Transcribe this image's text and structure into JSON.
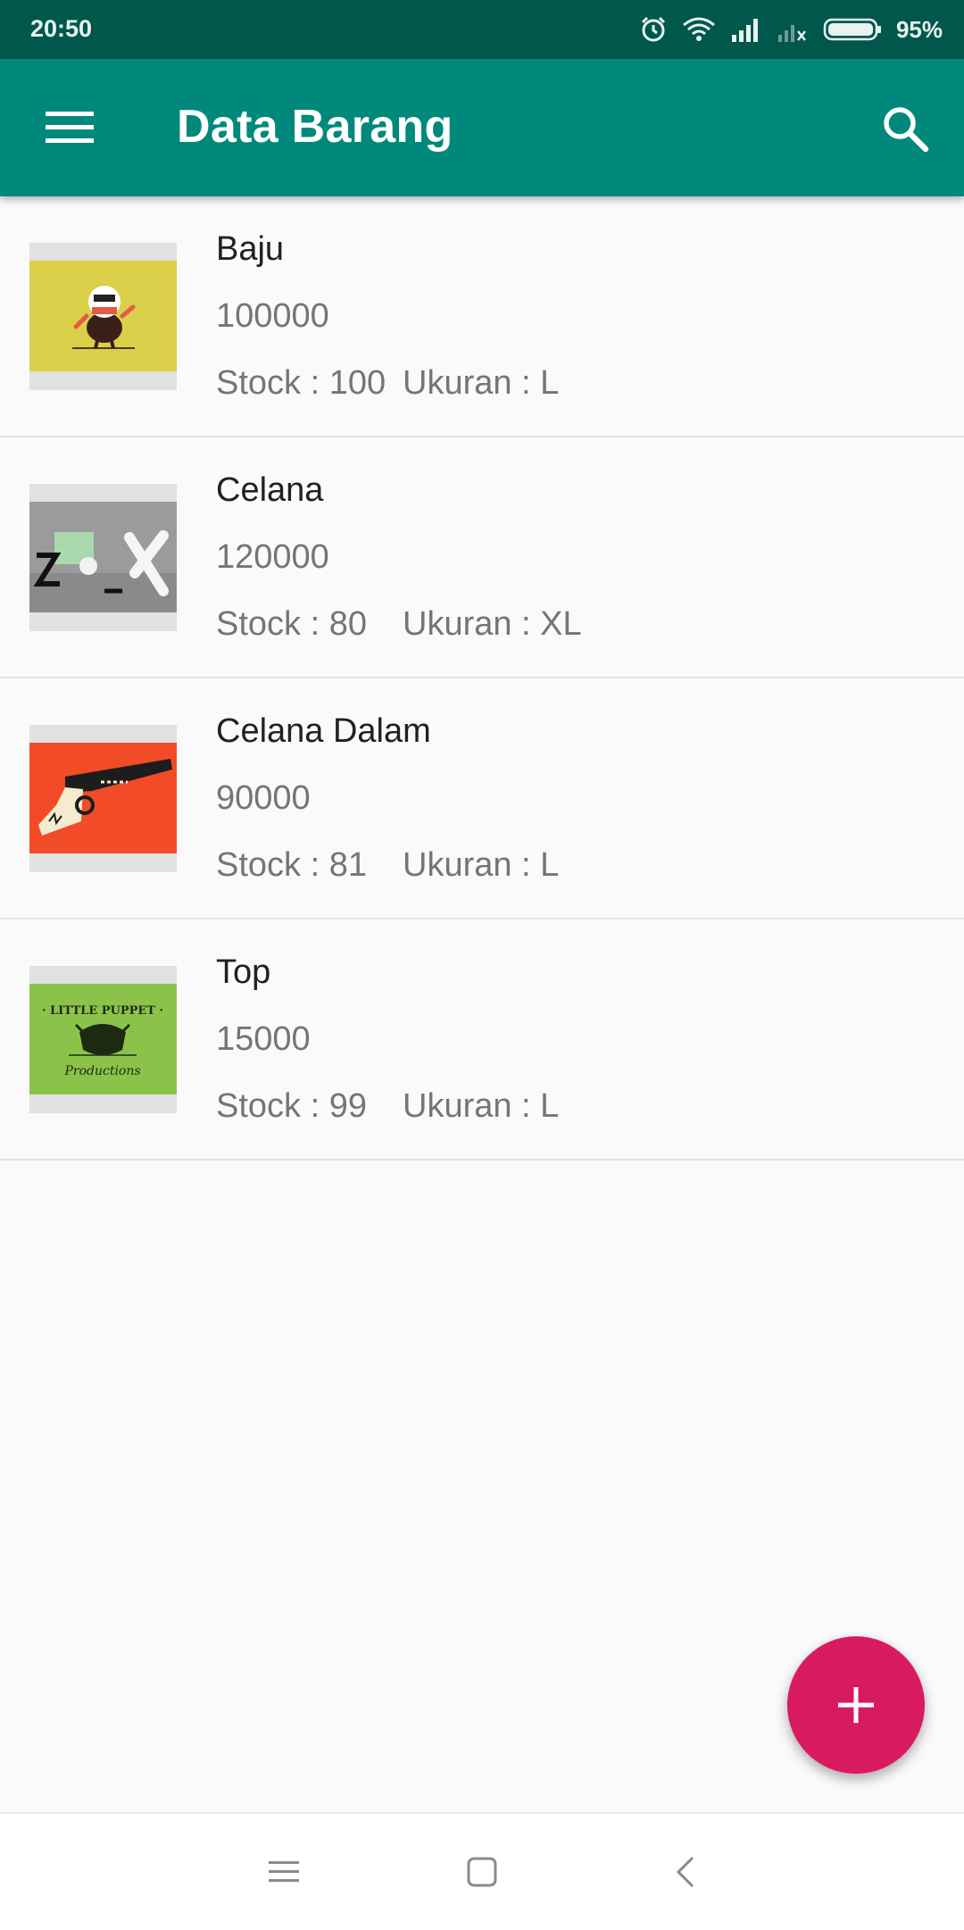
{
  "status_bar": {
    "time": "20:50",
    "battery": "95%",
    "icons": [
      "alarm-icon",
      "wifi-icon",
      "signal-icon",
      "no-signal-icon",
      "battery-icon"
    ]
  },
  "app_bar": {
    "title": "Data Barang",
    "menu_icon": "menu-icon",
    "search_icon": "search-icon",
    "color": "#00897b"
  },
  "items": [
    {
      "name": "Baju",
      "price": "100000",
      "stock": "Stock : 100",
      "size": "Ukuran : L",
      "thumb_bg": "#dccf4a"
    },
    {
      "name": "Celana",
      "price": "120000",
      "stock": "Stock : 80",
      "size": "Ukuran : XL",
      "thumb_bg": "#9b9b9b"
    },
    {
      "name": "Celana Dalam",
      "price": "90000",
      "stock": "Stock : 81",
      "size": "Ukuran : L",
      "thumb_bg": "#f24b27"
    },
    {
      "name": "Top",
      "price": "15000",
      "stock": "Stock : 99",
      "size": "Ukuran : L",
      "thumb_bg": "#8bc34a",
      "thumb_text": [
        "LITTLE PUPPET",
        "Productions"
      ]
    }
  ],
  "fab": {
    "icon": "plus-icon",
    "color": "#d81b60"
  },
  "nav_bar": {
    "icons": [
      "recents-icon",
      "home-icon",
      "back-icon"
    ]
  }
}
